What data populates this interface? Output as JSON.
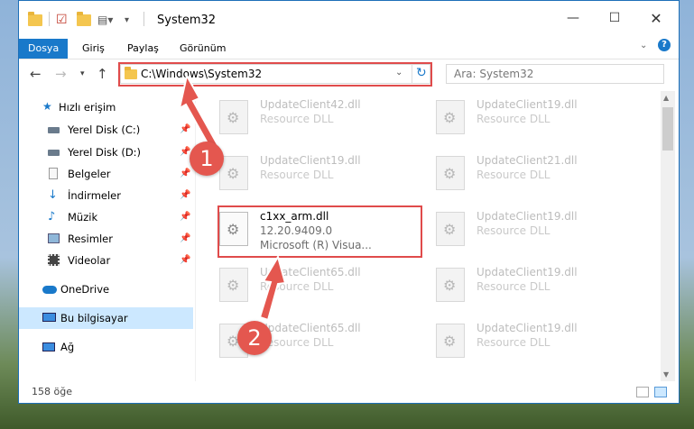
{
  "window": {
    "title": "System32"
  },
  "ribbon": {
    "tabs": [
      "Dosya",
      "Giriş",
      "Paylaş",
      "Görünüm"
    ]
  },
  "address": {
    "path": "C:\\Windows\\System32"
  },
  "search": {
    "placeholder": "Ara: System32"
  },
  "sidebar": {
    "items": [
      {
        "label": "Hızlı erişim",
        "icon": "star-icon"
      },
      {
        "label": "Yerel Disk (C:)",
        "icon": "drive-icon"
      },
      {
        "label": "Yerel Disk (D:)",
        "icon": "drive-icon"
      },
      {
        "label": "Belgeler",
        "icon": "documents-icon"
      },
      {
        "label": "İndirmeler",
        "icon": "download-icon"
      },
      {
        "label": "Müzik",
        "icon": "music-icon"
      },
      {
        "label": "Resimler",
        "icon": "pictures-icon"
      },
      {
        "label": "Videolar",
        "icon": "video-icon"
      },
      {
        "label": "OneDrive",
        "icon": "cloud-icon"
      },
      {
        "label": "Bu bilgisayar",
        "icon": "computer-icon"
      },
      {
        "label": "Ağ",
        "icon": "network-icon"
      }
    ]
  },
  "files": {
    "left": [
      {
        "name": "UpdateClient42.dll",
        "desc": "Resource DLL"
      },
      {
        "name": "UpdateClient19.dll",
        "desc": "Resource DLL"
      },
      {
        "name": "c1xx_arm.dll",
        "version": "12.20.9409.0",
        "desc": "Microsoft (R) Visua..."
      },
      {
        "name": "UpdateClient65.dll",
        "desc": "Resource DLL"
      },
      {
        "name": "UpdateClient65.dll",
        "desc": "Resource DLL"
      }
    ],
    "right": [
      {
        "name": "UpdateClient19.dll",
        "desc": "Resource DLL"
      },
      {
        "name": "UpdateClient21.dll",
        "desc": "Resource DLL"
      },
      {
        "name": "UpdateClient19.dll",
        "desc": "Resource DLL"
      },
      {
        "name": "UpdateClient19.dll",
        "desc": "Resource DLL"
      },
      {
        "name": "UpdateClient19.dll",
        "desc": "Resource DLL"
      }
    ]
  },
  "status": {
    "item_count": "158 öğe"
  },
  "annotations": {
    "step1": "1",
    "step2": "2"
  },
  "colors": {
    "accent": "#1979ca",
    "highlight": "#e04b4b",
    "selected": "#cce8ff"
  }
}
